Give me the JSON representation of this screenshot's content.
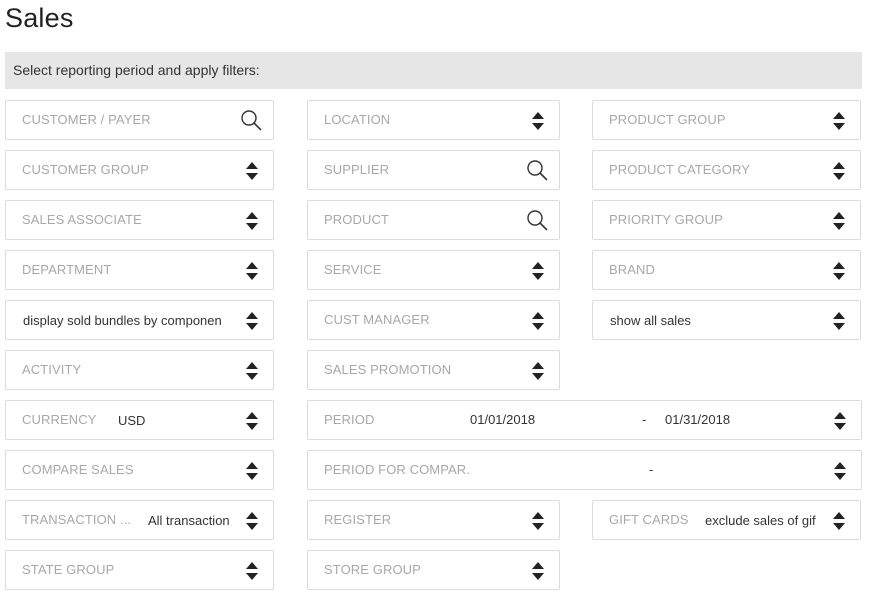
{
  "page": {
    "title": "Sales",
    "filter_bar_text": "Select reporting period and apply filters:"
  },
  "fields": {
    "customer_payer": {
      "label": "CUSTOMER / PAYER"
    },
    "location": {
      "label": "LOCATION"
    },
    "product_group": {
      "label": "PRODUCT GROUP"
    },
    "customer_group": {
      "label": "CUSTOMER GROUP"
    },
    "supplier": {
      "label": "SUPPLIER"
    },
    "product_category": {
      "label": "PRODUCT CATEGORY"
    },
    "sales_associate": {
      "label": "SALES ASSOCIATE"
    },
    "product": {
      "label": "PRODUCT"
    },
    "priority_group": {
      "label": "PRIORITY GROUP"
    },
    "department": {
      "label": "DEPARTMENT"
    },
    "service": {
      "label": "SERVICE"
    },
    "brand": {
      "label": "BRAND"
    },
    "bundles": {
      "value": "display sold bundles by componen"
    },
    "cust_manager": {
      "label": "CUST MANAGER"
    },
    "sales_mode": {
      "value": "show all sales"
    },
    "activity": {
      "label": "ACTIVITY"
    },
    "sales_promotion": {
      "label": "SALES PROMOTION"
    },
    "currency": {
      "label": "CURRENCY",
      "value": "USD"
    },
    "period": {
      "label": "PERIOD",
      "from": "01/01/2018",
      "separator": "-",
      "to": "01/31/2018"
    },
    "compare_sales": {
      "label": "COMPARE SALES"
    },
    "period_for_compar": {
      "label": "PERIOD FOR COMPAR.",
      "separator": "-"
    },
    "transaction": {
      "label": "TRANSACTION ...",
      "value": "All transaction"
    },
    "register": {
      "label": "REGISTER"
    },
    "gift_cards": {
      "label": "GIFT CARDS",
      "value": "exclude sales of gif"
    },
    "state_group": {
      "label": "STATE GROUP"
    },
    "store_group": {
      "label": "STORE GROUP"
    }
  },
  "icons": {
    "sort": "sort-updown-icon",
    "search": "search-icon"
  }
}
